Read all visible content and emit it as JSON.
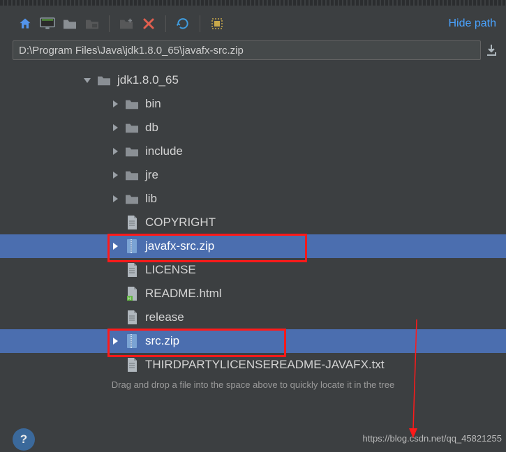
{
  "toolbar": {
    "hide_path_label": "Hide path",
    "icons": {
      "home": "home-icon",
      "desktop": "desktop-icon",
      "project": "folder-dark-icon",
      "module": "folder-module-icon",
      "new_folder": "new-folder-icon",
      "delete": "delete-icon",
      "refresh": "refresh-icon",
      "show_hidden": "show-hidden-icon"
    }
  },
  "path": "D:\\Program Files\\Java\\jdk1.8.0_65\\javafx-src.zip",
  "tree": {
    "root": "jdk1.8.0_65",
    "children": [
      {
        "type": "folder",
        "name": "bin"
      },
      {
        "type": "folder",
        "name": "db"
      },
      {
        "type": "folder",
        "name": "include"
      },
      {
        "type": "folder",
        "name": "jre"
      },
      {
        "type": "folder",
        "name": "lib"
      },
      {
        "type": "file",
        "name": "COPYRIGHT",
        "icon": "text"
      },
      {
        "type": "zip",
        "name": "javafx-src.zip",
        "selected": true,
        "annotated": true
      },
      {
        "type": "file",
        "name": "LICENSE",
        "icon": "text"
      },
      {
        "type": "file",
        "name": "README.html",
        "icon": "html"
      },
      {
        "type": "file",
        "name": "release",
        "icon": "text"
      },
      {
        "type": "zip",
        "name": "src.zip",
        "selected": true,
        "annotated": true
      },
      {
        "type": "file",
        "name": "THIRDPARTYLICENSEREADME-JAVAFX.txt",
        "icon": "text"
      }
    ]
  },
  "hint": "Drag and drop a file into the space above to quickly locate it in the tree",
  "help_label": "?",
  "watermark": "https://blog.csdn.net/qq_45821255",
  "colors": {
    "selection": "#4b6eaf",
    "annotation": "#ff1a1a",
    "link": "#4aa3ff"
  }
}
